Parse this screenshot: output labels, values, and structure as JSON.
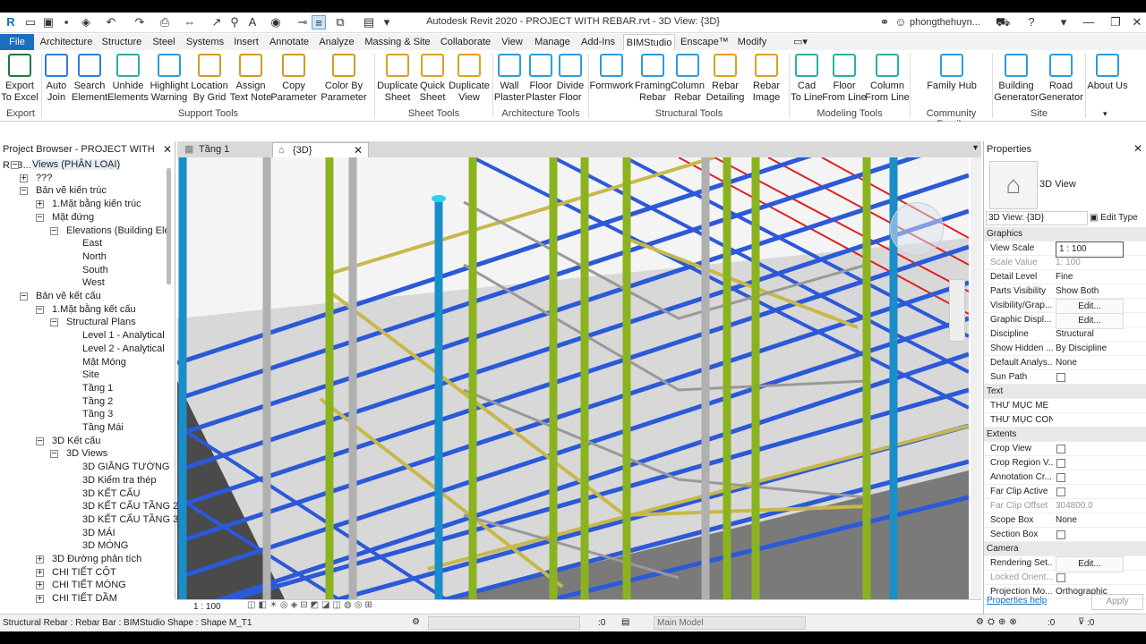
{
  "window": {
    "title": "Autodesk Revit 2020 - PROJECT WITH REBAR.rvt - 3D View: {3D}",
    "user": "phongthehuyn..."
  },
  "menu": [
    "File",
    "Architecture",
    "Structure",
    "Steel",
    "Systems",
    "Insert",
    "Annotate",
    "Analyze",
    "Massing & Site",
    "Collaborate",
    "View",
    "Manage",
    "Add-Ins",
    "BIMStudio",
    "Enscape™",
    "Modify"
  ],
  "ribbon": {
    "buttons": [
      {
        "label": "Export\nTo Excel",
        "icon": "excel-export-icon",
        "color": "#1e7d3a"
      },
      {
        "label": "Auto\nJoin",
        "icon": "auto-join-icon",
        "color": "#2b7de0"
      },
      {
        "label": "Search\nElement",
        "icon": "search-icon",
        "color": "#2b7de0"
      },
      {
        "label": "Unhide\nElements",
        "icon": "unhide-icon",
        "color": "#2bb0a0"
      },
      {
        "label": "Highlight\nWarning",
        "icon": "highlight-warning-icon",
        "color": "#2b9de0"
      },
      {
        "label": "Location\nBy Grid",
        "icon": "location-icon",
        "color": "#d49a20"
      },
      {
        "label": "Assign\nText Note",
        "icon": "text-note-icon",
        "color": "#d49a20"
      },
      {
        "label": "Copy\nParameter",
        "icon": "copy-parameter-icon",
        "color": "#d49a20"
      },
      {
        "label": "Color By\nParameter",
        "icon": "color-parameter-icon",
        "color": "#d49a20"
      },
      {
        "label": "Duplicate\nSheet",
        "icon": "duplicate-sheet-icon",
        "color": "#e0a020"
      },
      {
        "label": "Quick\nSheet",
        "icon": "quick-sheet-icon",
        "color": "#e0a020"
      },
      {
        "label": "Duplicate\nView",
        "icon": "duplicate-view-icon",
        "color": "#e0a020"
      },
      {
        "label": "Wall\nPlaster",
        "icon": "wall-plaster-icon",
        "color": "#2b9de0"
      },
      {
        "label": "Floor\nPlaster",
        "icon": "floor-plaster-icon",
        "color": "#2b9de0"
      },
      {
        "label": "Divide\nFloor",
        "icon": "divide-floor-icon",
        "color": "#2b9de0"
      },
      {
        "label": "Formwork",
        "icon": "formwork-icon",
        "color": "#2b9de0"
      },
      {
        "label": "Framing\nRebar",
        "icon": "framing-rebar-icon",
        "color": "#2b9de0"
      },
      {
        "label": "Column\nRebar",
        "icon": "column-rebar-icon",
        "color": "#2b9de0"
      },
      {
        "label": "Rebar\nDetailing",
        "icon": "rebar-detailing-icon",
        "color": "#e0a020"
      },
      {
        "label": "Rebar\nImage",
        "icon": "rebar-image-icon",
        "color": "#e0a020"
      },
      {
        "label": "Cad\nTo Line",
        "icon": "cad-to-line-icon",
        "color": "#2bb0a0"
      },
      {
        "label": "Floor\nFrom Line",
        "icon": "floor-from-line-icon",
        "color": "#2bb0a0"
      },
      {
        "label": "Column\nFrom Line",
        "icon": "column-from-line-icon",
        "color": "#2bb0a0"
      },
      {
        "label": "Family Hub",
        "icon": "family-hub-icon",
        "color": "#2b9de0"
      },
      {
        "label": "Building\nGenerator",
        "icon": "building-generator-icon",
        "color": "#2b9de0"
      },
      {
        "label": "Road\nGenerator",
        "icon": "road-generator-icon",
        "color": "#2b9de0"
      },
      {
        "label": "About Us",
        "icon": "about-us-icon",
        "color": "#2b9de0"
      }
    ],
    "groups": [
      "Export",
      "Support Tools",
      "Sheet Tools",
      "Architecture Tools",
      "Structural Tools",
      "Modeling Tools",
      "Community Family",
      "Site"
    ]
  },
  "project_browser": {
    "title": "Project Browser - PROJECT WITH REB...",
    "items": [
      {
        "label": "Views (PHÂN LOẠI)",
        "level": 0
      },
      {
        "label": "???",
        "level": 1
      },
      {
        "label": "Bản vẽ kiến trúc",
        "level": 1
      },
      {
        "label": "1.Mặt bằng kiến trúc",
        "level": 2
      },
      {
        "label": "Mặt đứng",
        "level": 2
      },
      {
        "label": "Elevations (Building Ele",
        "level": 3
      },
      {
        "label": "East",
        "level": 4
      },
      {
        "label": "North",
        "level": 4
      },
      {
        "label": "South",
        "level": 4
      },
      {
        "label": "West",
        "level": 4
      },
      {
        "label": "Bản vẽ kết cấu",
        "level": 1
      },
      {
        "label": "1.Mặt bằng kết cấu",
        "level": 2
      },
      {
        "label": "Structural Plans",
        "level": 3
      },
      {
        "label": "Level 1 - Analytical",
        "level": 4
      },
      {
        "label": "Level 2 - Analytical",
        "level": 4
      },
      {
        "label": "Mặt Móng",
        "level": 4
      },
      {
        "label": "Site",
        "level": 4
      },
      {
        "label": "Tầng 1",
        "level": 4
      },
      {
        "label": "Tầng 2",
        "level": 4
      },
      {
        "label": "Tầng 3",
        "level": 4
      },
      {
        "label": "Tầng Mái",
        "level": 4
      },
      {
        "label": "3D Kết cấu",
        "level": 2
      },
      {
        "label": "3D Views",
        "level": 3
      },
      {
        "label": "3D GIẰNG TƯỜNG",
        "level": 4
      },
      {
        "label": "3D Kiểm tra thép",
        "level": 4
      },
      {
        "label": "3D KẾT CẤU",
        "level": 4
      },
      {
        "label": "3D KẾT CẤU TẦNG 2",
        "level": 4
      },
      {
        "label": "3D KẾT CẤU TẦNG 3",
        "level": 4
      },
      {
        "label": "3D MÁI",
        "level": 4
      },
      {
        "label": "3D MÓNG",
        "level": 4
      },
      {
        "label": "3D Đường phân tích",
        "level": 2
      },
      {
        "label": "CHI TIẾT CỘT",
        "level": 2
      },
      {
        "label": "CHI TIẾT MÓNG",
        "level": 2
      },
      {
        "label": "CHI TIẾT DẦM",
        "level": 2
      }
    ]
  },
  "view_tabs": [
    {
      "label": "Tầng 1",
      "active": false
    },
    {
      "label": "{3D}",
      "active": true
    }
  ],
  "view_scale": "1 : 100",
  "properties": {
    "title": "Properties",
    "type": "3D View",
    "selector": "3D View: {3D}",
    "edit_type": "Edit Type",
    "rows": [
      {
        "kind": "section",
        "label": "Graphics"
      },
      {
        "label": "View Scale",
        "value": "1 : 100"
      },
      {
        "label": "Scale Value",
        "value": "1:  100",
        "disabled": true
      },
      {
        "label": "Detail Level",
        "value": "Fine"
      },
      {
        "label": "Parts Visibility",
        "value": "Show Both"
      },
      {
        "label": "Visibility/Grap...",
        "value": "Edit...",
        "button": true
      },
      {
        "label": "Graphic Displ...",
        "value": "Edit...",
        "button": true
      },
      {
        "label": "Discipline",
        "value": "Structural"
      },
      {
        "label": "Show Hidden ...",
        "value": "By Discipline"
      },
      {
        "label": "Default Analys...",
        "value": "None"
      },
      {
        "label": "Sun Path",
        "value": "",
        "checkbox": true
      },
      {
        "kind": "section",
        "label": "Text"
      },
      {
        "label": "THƯ MỤC MẸ",
        "value": ""
      },
      {
        "label": "THƯ MỤC CON",
        "value": ""
      },
      {
        "kind": "section",
        "label": "Extents"
      },
      {
        "label": "Crop View",
        "value": "",
        "checkbox": true
      },
      {
        "label": "Crop Region V...",
        "value": "",
        "checkbox": true
      },
      {
        "label": "Annotation Cr...",
        "value": "",
        "checkbox": true
      },
      {
        "label": "Far Clip Active",
        "value": "",
        "checkbox": true
      },
      {
        "label": "Far Clip Offset",
        "value": "304800.0",
        "disabled": true
      },
      {
        "label": "Scope Box",
        "value": "None"
      },
      {
        "label": "Section Box",
        "value": "",
        "checkbox": true
      },
      {
        "kind": "section",
        "label": "Camera"
      },
      {
        "label": "Rendering Set...",
        "value": "Edit...",
        "button": true
      },
      {
        "label": "Locked Orient...",
        "value": "",
        "checkbox": true,
        "disabled": true
      },
      {
        "label": "Projection Mo...",
        "value": "Orthographic"
      }
    ],
    "help": "Properties help",
    "apply": "Apply"
  },
  "status": {
    "text": "Structural Rebar : Rebar Bar : BIMStudio Shape : Shape M_T1",
    "zero1": ":0",
    "model": "Main Model",
    "zero2": ":0",
    "filter": ":0"
  }
}
